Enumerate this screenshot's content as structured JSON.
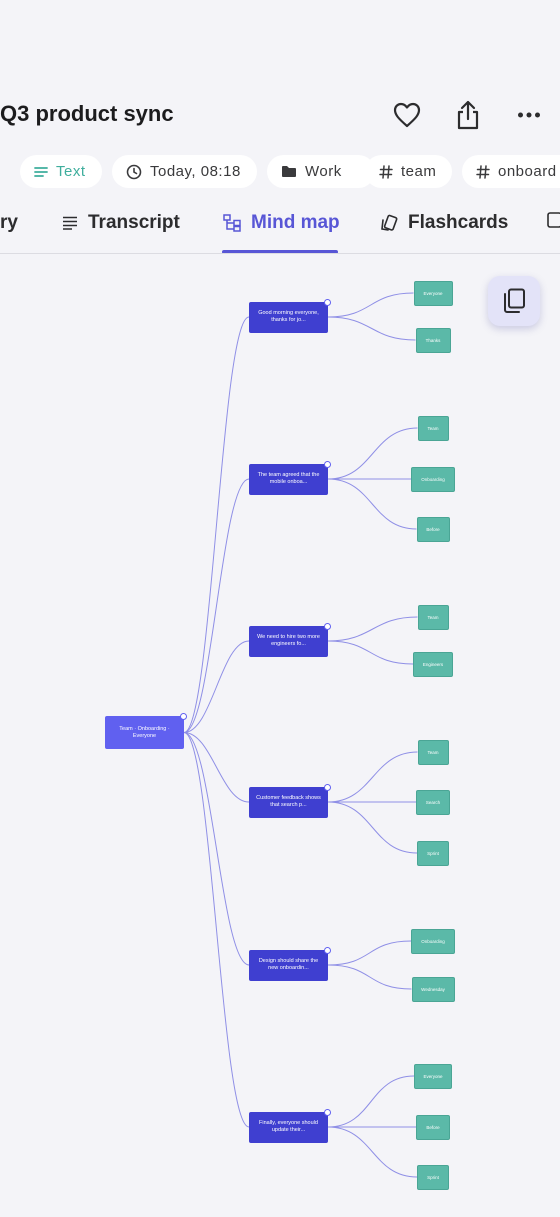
{
  "header": {
    "title": "Q3 product sync",
    "icons": [
      "heart-icon",
      "share-icon",
      "more-icon"
    ]
  },
  "chips": [
    {
      "label": "Text",
      "icon": "text-lines-icon"
    },
    {
      "label": "Today, 08:18",
      "icon": "clock-icon"
    },
    {
      "label": "Work",
      "icon": "folder-icon"
    },
    {
      "label": "team",
      "icon": "hash-icon"
    },
    {
      "label": "onboard",
      "icon": "hash-icon"
    }
  ],
  "tabs": [
    {
      "label": "ry"
    },
    {
      "label": "Transcript",
      "icon": "transcript-icon"
    },
    {
      "label": "Mind map",
      "icon": "mind-map-icon",
      "active": true
    },
    {
      "label": "Flashcards",
      "icon": "flashcards-icon"
    }
  ],
  "mindmap": {
    "root": "Team · Onboarding · Everyone",
    "branches": [
      {
        "label": "Good morning everyone, thanks for jo...",
        "leaves": [
          "Everyone",
          "Thanks"
        ]
      },
      {
        "label": "The team agreed that the mobile onboa...",
        "leaves": [
          "Team",
          "Onboarding",
          "Before"
        ]
      },
      {
        "label": "We need to hire two more engineers fo...",
        "leaves": [
          "Team",
          "Engineers"
        ]
      },
      {
        "label": "Customer feedback shows that search p...",
        "leaves": [
          "Team",
          "Search",
          "Sprint"
        ]
      },
      {
        "label": "Design should share the new onboardin...",
        "leaves": [
          "Onboarding",
          "Wednesday"
        ]
      },
      {
        "label": "Finally, everyone should update their...",
        "leaves": [
          "Everyone",
          "Before",
          "Sprint"
        ]
      }
    ]
  },
  "colors": {
    "accent": "#5856d6",
    "root_node": "#6060f0",
    "branch_node": "#3f3fd0",
    "leaf_node": "#5bb9a8",
    "connector": "#8f8fe6",
    "chip_text_active": "#3fae9d"
  },
  "copy_button": {
    "icon": "copy-icon"
  }
}
